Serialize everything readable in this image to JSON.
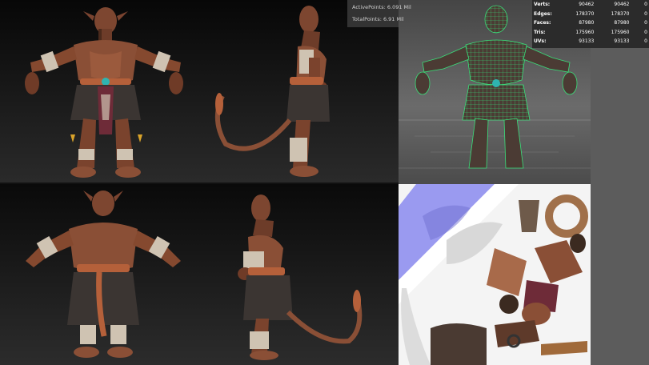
{
  "hud": {
    "active_points": "ActivePoints: 6.091 Mil",
    "total_points": "TotalPoints: 6.91 Mil"
  },
  "stats": {
    "rows": [
      {
        "label": "Verts:",
        "a": "90462",
        "b": "90462",
        "c": "0"
      },
      {
        "label": "Edges:",
        "a": "178370",
        "b": "178370",
        "c": "0"
      },
      {
        "label": "Faces:",
        "a": "87980",
        "b": "87980",
        "c": "0"
      },
      {
        "label": "Tris:",
        "a": "175960",
        "b": "175960",
        "c": "0"
      },
      {
        "label": "UVs:",
        "a": "93133",
        "b": "93133",
        "c": "0"
      }
    ]
  },
  "colors": {
    "skin": "#8a4f36",
    "skin_dark": "#5e3222",
    "cloth": "#3b3532",
    "bandage": "#cfc3b2",
    "wire": "#39e07a",
    "normal_map": "#8f8ff2"
  }
}
